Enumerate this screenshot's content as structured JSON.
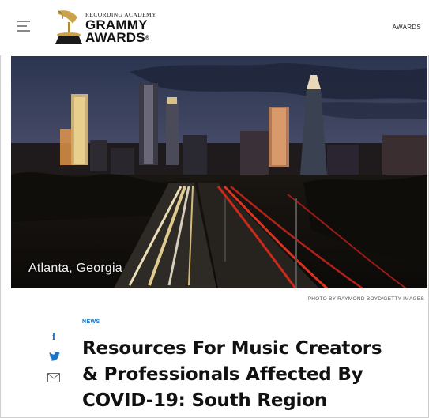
{
  "header": {
    "logo_small": "RECORDING ACADEMY",
    "logo_line1": "GRAMMY",
    "logo_line2": "AWARDS",
    "logo_reg": "®",
    "nav_awards": "AWARDS"
  },
  "hero": {
    "caption": "Atlanta, Georgia",
    "credit": "PHOTO BY RAYMOND BOYD/GETTY IMAGES"
  },
  "article": {
    "kicker": "NEWS",
    "title_lines": [
      "Resources For Music Creators",
      "& Professionals Affected By",
      "COVID-19: South Region"
    ]
  },
  "share": {
    "facebook_glyph": "f"
  },
  "colors": {
    "accent_blue": "#1a73c7",
    "text_dark": "#111111"
  },
  "icons": [
    "hamburger-menu-icon",
    "grammy-gramophone-icon",
    "facebook-icon",
    "twitter-icon",
    "mail-icon"
  ]
}
